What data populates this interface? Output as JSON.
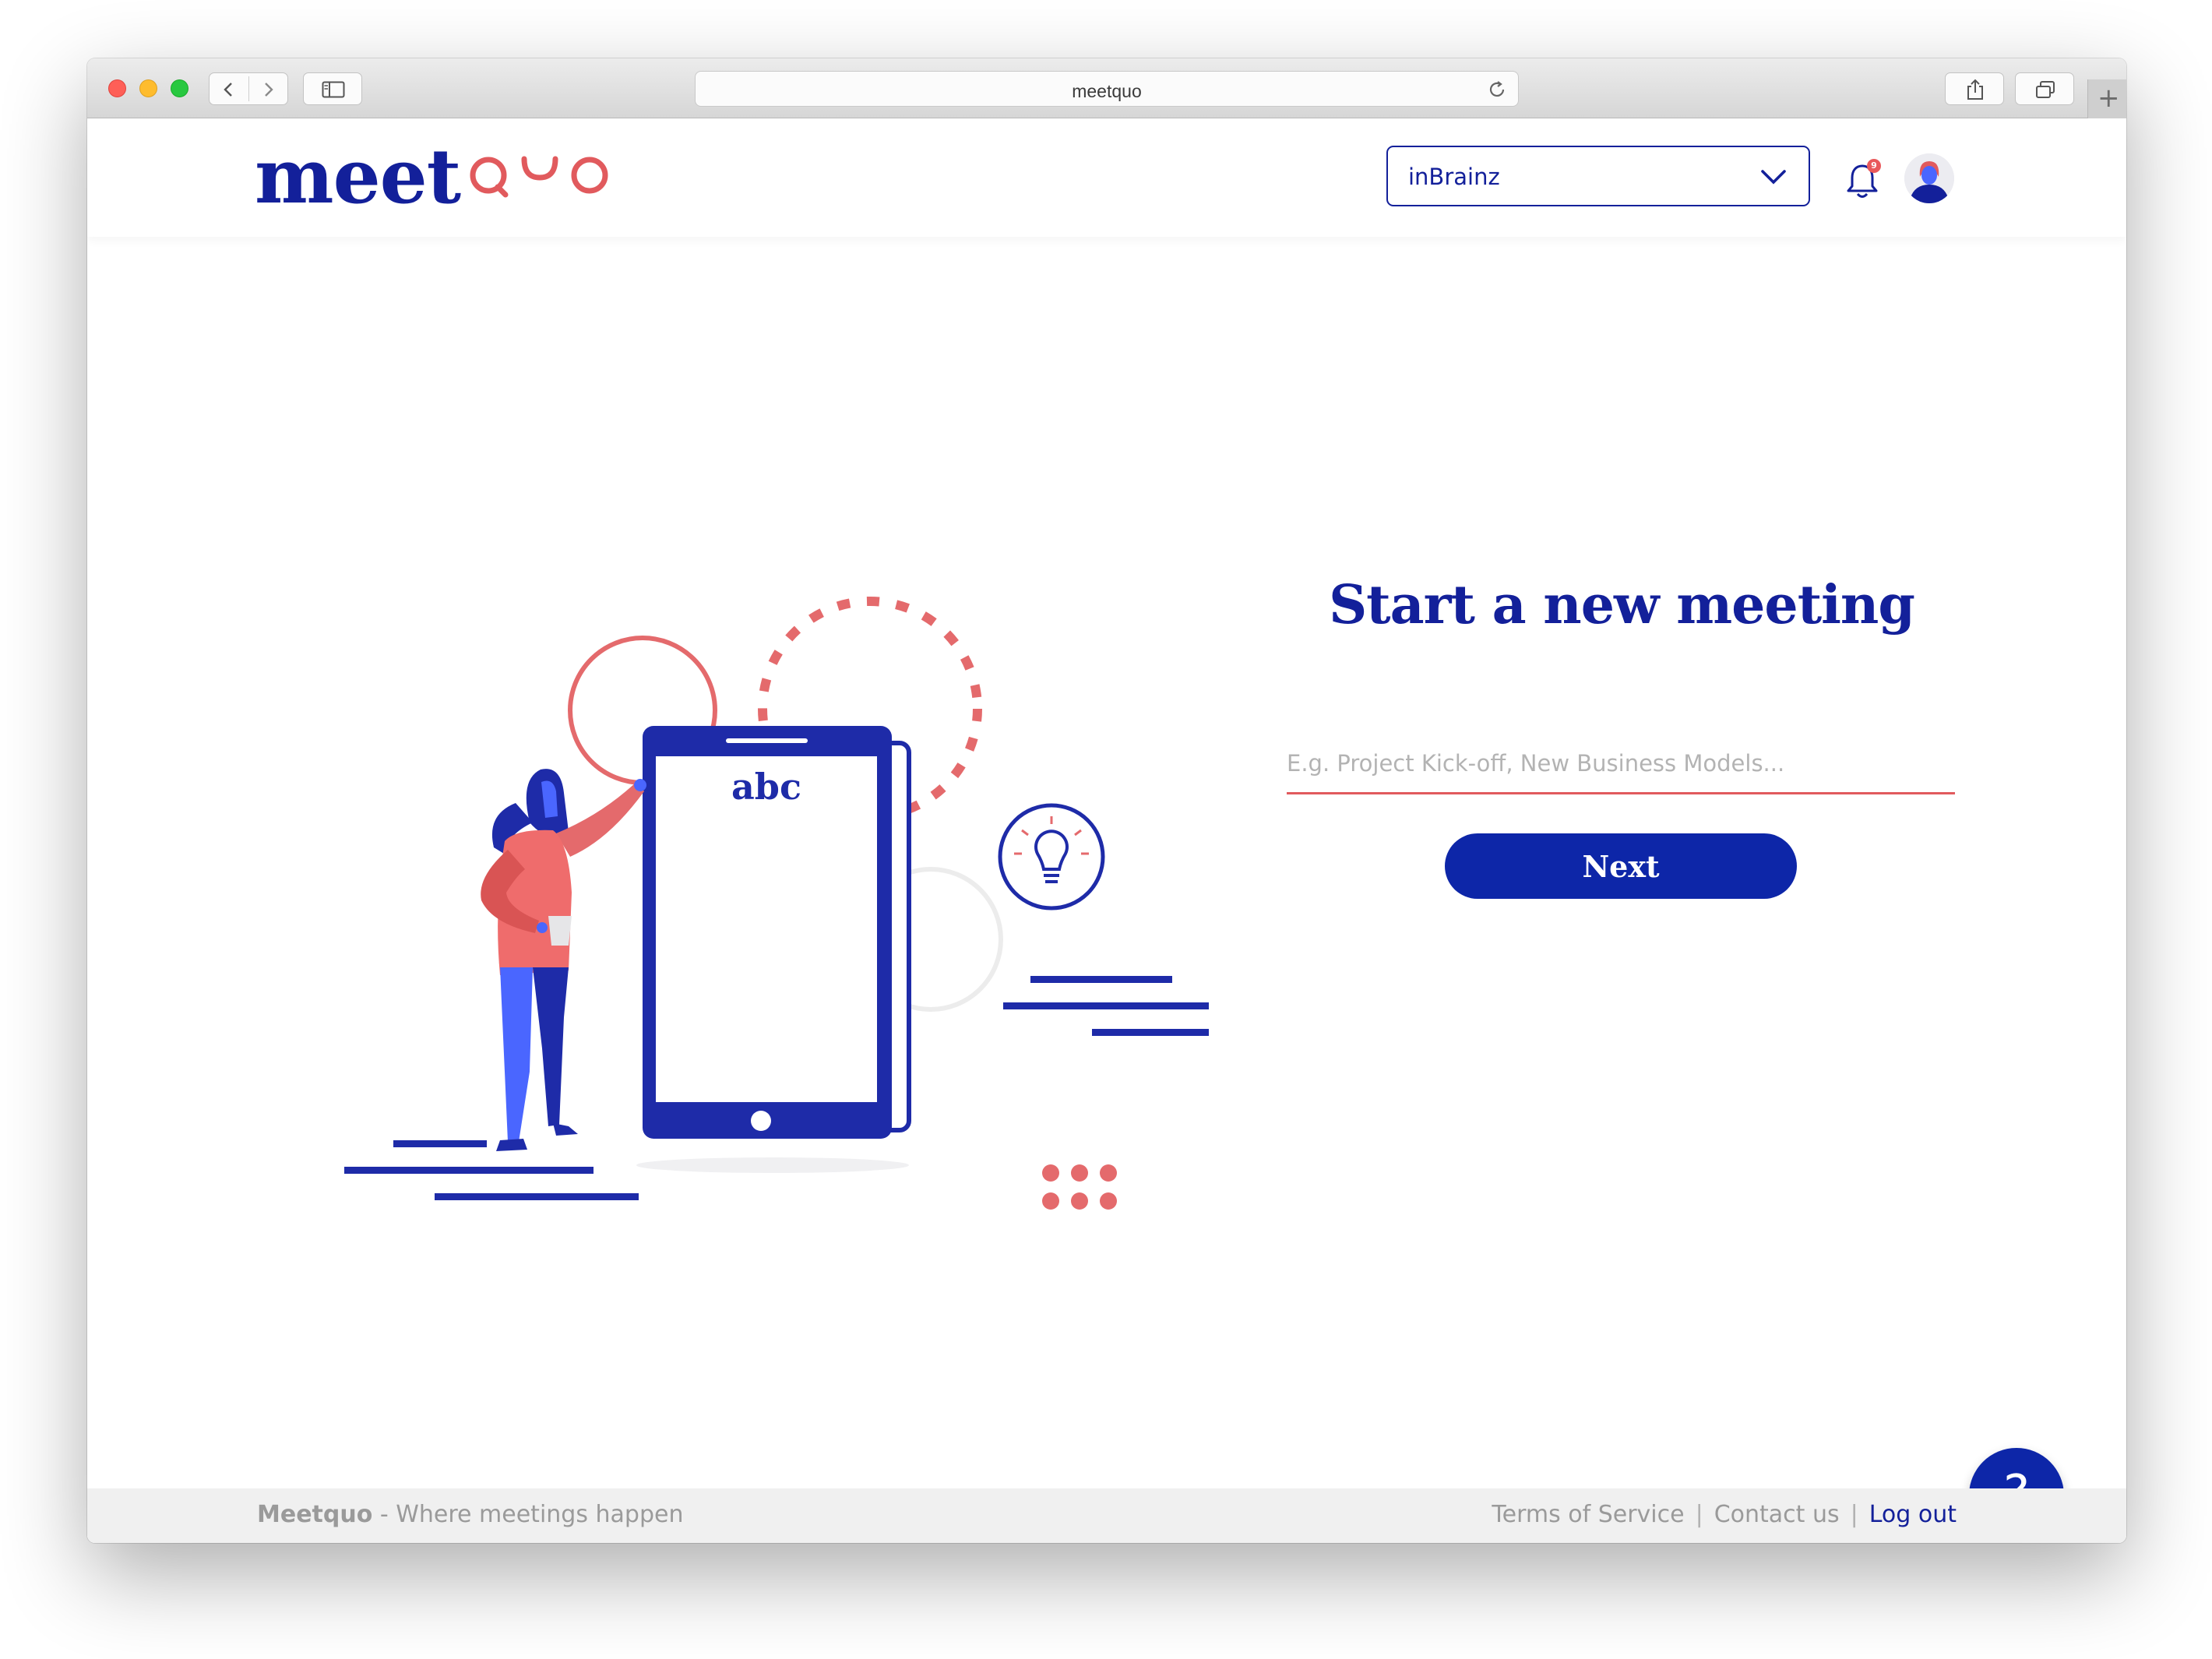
{
  "browser": {
    "url": "meetquo"
  },
  "header": {
    "logo_text": "meet",
    "logo_accent": "quo",
    "org_selector_value": "inBrainz",
    "notification_count": "9"
  },
  "illustration": {
    "screen_text": "abc"
  },
  "form": {
    "title": "Start a new meeting",
    "input_placeholder": "E.g. Project Kick-off, New Business Models...",
    "input_value": "",
    "next_label": "Next"
  },
  "help": {
    "label": "?"
  },
  "footer": {
    "brand": "Meetquo",
    "tagline": " - Where meetings happen",
    "terms": "Terms of Service",
    "contact": "Contact us",
    "logout": "Log out",
    "separator": "|"
  },
  "colors": {
    "brand_blue": "#13209a",
    "button_blue": "#0d26a8",
    "accent_coral": "#e15a5d"
  },
  "icons": {
    "back": "chevron-left-icon",
    "forward": "chevron-right-icon",
    "sidebar": "sidebar-icon",
    "reload": "reload-icon",
    "share": "share-icon",
    "tabs": "tabs-icon",
    "dropdown": "chevron-down-icon",
    "bell": "bell-icon",
    "lightbulb": "lightbulb-icon"
  }
}
